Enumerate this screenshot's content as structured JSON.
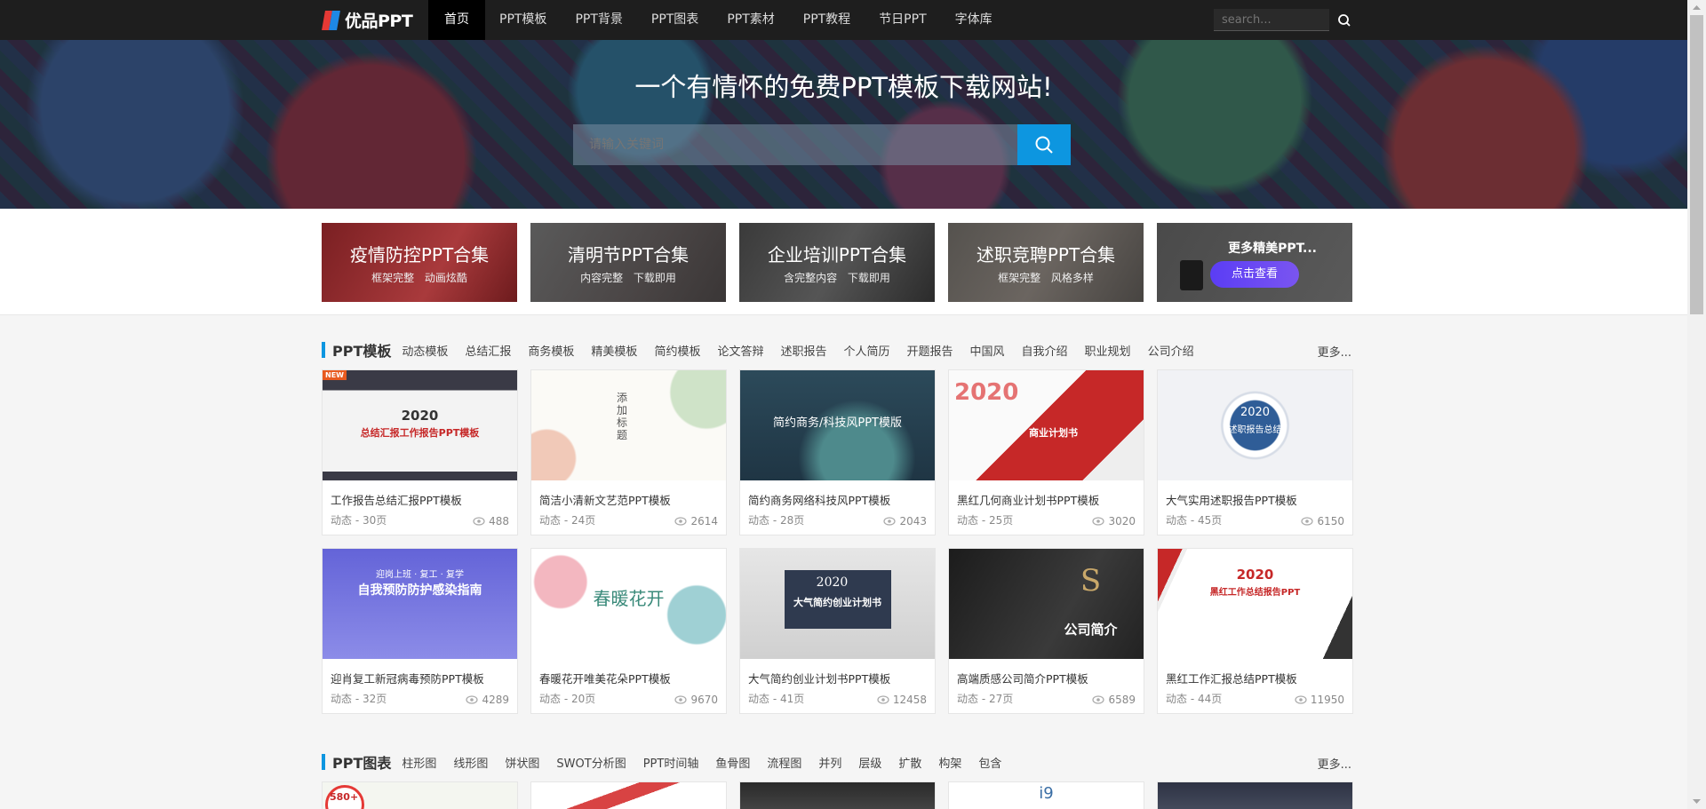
{
  "header": {
    "logo_text": "优品PPT",
    "nav": [
      "首页",
      "PPT模板",
      "PPT背景",
      "PPT图表",
      "PPT素材",
      "PPT教程",
      "节日PPT",
      "字体库"
    ],
    "search_placeholder": "search..."
  },
  "banner": {
    "title": "一个有情怀的免费PPT模板下载网站!",
    "search_placeholder": "请输入关键词"
  },
  "features": [
    {
      "title": "疫情防控PPT合集",
      "sub": "框架完整 动画炫酷"
    },
    {
      "title": "清明节PPT合集",
      "sub": "内容完整 下载即用"
    },
    {
      "title": "企业培训PPT合集",
      "sub": "含完整内容 下载即用"
    },
    {
      "title": "述职竞聘PPT合集",
      "sub": "框架完整 风格多样"
    },
    {
      "title": "更多精美PPT...",
      "cta": "点击查看"
    }
  ],
  "sections": {
    "templates": {
      "title": "PPT模板",
      "tags": [
        "动态模板",
        "总结汇报",
        "商务模板",
        "精美模板",
        "简约模板",
        "论文答辩",
        "述职报告",
        "个人简历",
        "开题报告",
        "中国风",
        "自我介绍",
        "职业规划",
        "公司介绍"
      ],
      "more": "更多..."
    },
    "charts": {
      "title": "PPT图表",
      "tags": [
        "柱形图",
        "线形图",
        "饼状图",
        "SWOT分析图",
        "PPT时间轴",
        "鱼骨图",
        "流程图",
        "并列",
        "层级",
        "扩散",
        "构架",
        "包含"
      ],
      "more": "更多..."
    }
  },
  "cards": [
    {
      "name": "工作报告总结汇报PPT模板",
      "meta": "动态 - 30页",
      "views": "488",
      "thumb_title": "2020",
      "thumb_sub": "总结汇报工作报告PPT模板",
      "thumb_tag": "NEW"
    },
    {
      "name": "简洁小清新文艺范PPT模板",
      "meta": "动态 - 24页",
      "views": "2614",
      "thumb_title": "添加标题"
    },
    {
      "name": "简约商务网络科技风PPT模板",
      "meta": "动态 - 28页",
      "views": "2043",
      "thumb_title": "简约商务/科技风PPT模版"
    },
    {
      "name": "黑红几何商业计划书PPT模板",
      "meta": "动态 - 25页",
      "views": "3020",
      "thumb_title": "2020",
      "thumb_sub": "商业计划书"
    },
    {
      "name": "大气实用述职报告PPT模板",
      "meta": "动态 - 45页",
      "views": "6150",
      "thumb_title": "2020",
      "thumb_sub": "述职报告总结"
    },
    {
      "name": "迎肖复工新冠病毒预防PPT模板",
      "meta": "动态 - 32页",
      "views": "4289",
      "thumb_title": "自我预防防护感染指南",
      "thumb_sub": "迎岗上班 · 复工 · 复学"
    },
    {
      "name": "春暖花开唯美花朵PPT模板",
      "meta": "动态 - 20页",
      "views": "9670",
      "thumb_title": "春暖花开"
    },
    {
      "name": "大气简约创业计划书PPT模板",
      "meta": "动态 - 41页",
      "views": "12458",
      "thumb_title": "2020",
      "thumb_sub": "大气简约创业计划书"
    },
    {
      "name": "高端质感公司简介PPT模板",
      "meta": "动态 - 27页",
      "views": "6589",
      "thumb_title": "S",
      "thumb_sub": "公司简介"
    },
    {
      "name": "黑红工作汇报总结PPT模板",
      "meta": "动态 - 44页",
      "views": "11950",
      "thumb_title": "2020",
      "thumb_sub": "黑红工作总结报告PPT"
    }
  ],
  "chart_cards_partial": [
    "580+",
    "",
    "",
    "i9",
    ""
  ],
  "colors": {
    "accent": "#0d96e0",
    "nav_bg": "#1e1e1e",
    "cta": "#6a48f2"
  }
}
